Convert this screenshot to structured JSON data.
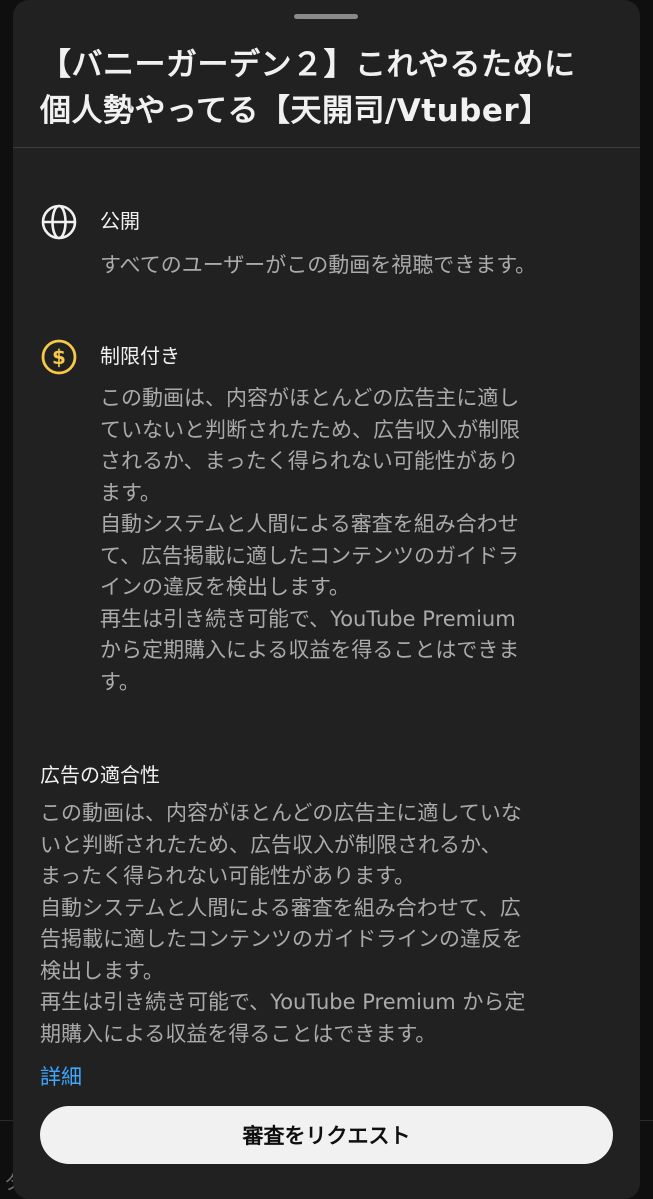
{
  "video": {
    "title": "【バニーガーデン２】これやるために\n個人勢やってる【天開司/Vtuber】"
  },
  "visibility": {
    "icon": "globe-icon",
    "title": "公開",
    "description": "すべてのユーザーがこの動画を視聴できます。"
  },
  "monetization": {
    "icon": "dollar-coin-icon",
    "icon_color": "#f7c948",
    "title": "制限付き",
    "description": "この動画は、内容がほとんどの広告主に適し\nていないと判断されたため、広告収入が制限\nされるか、まったく得られない可能性があり\nます。\n自動システムと人間による審査を組み合わせ\nて、広告掲載に適したコンテンツのガイドラ\nインの違反を検出します。\n再生は引き続き可能で、YouTube Premium\nから定期購入による収益を得ることはできま\nす。"
  },
  "ad_suitability": {
    "title": "広告の適合性",
    "description": "この動画は、内容がほとんどの広告主に適していな\nいと判断されたため、広告収入が制限されるか、\nまったく得られない可能性があります。\n自動システムと人間による審査を組み合わせて、広\n告掲載に適したコンテンツのガイドラインの違反を\n検出します。\n再生は引き続き可能で、YouTube Premium から定\n期購入による収益を得ることはできます。",
    "details_link": "詳細"
  },
  "actions": {
    "request_review": "審査をリクエスト"
  },
  "background": {
    "partial_text": "タ"
  },
  "colors": {
    "sheet_background": "#212121",
    "link": "#3ea6ff",
    "button_background": "#f1f1f1",
    "secondary_text": "#aaaaaa"
  }
}
